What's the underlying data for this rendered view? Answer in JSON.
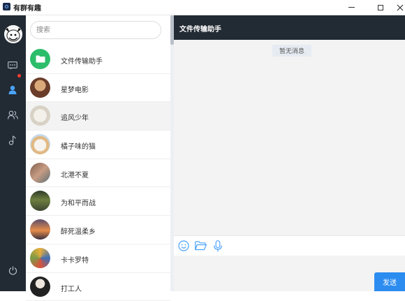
{
  "app": {
    "title": "有群有趣"
  },
  "window": {
    "min_icon": "minimize-icon",
    "max_icon": "maximize-icon",
    "close_icon": "close-icon"
  },
  "rail": {
    "items": [
      {
        "icon": "chat-icon",
        "has_badge": true
      },
      {
        "icon": "contact-icon",
        "active": true
      },
      {
        "icon": "group-icon"
      },
      {
        "icon": "music-note-icon"
      },
      {
        "icon": "power-icon"
      }
    ],
    "accent": "#4aa3ff",
    "badge_color": "#ff3b30"
  },
  "search": {
    "placeholder": "搜索"
  },
  "contacts": [
    {
      "name": "文件传输助手"
    },
    {
      "name": "星梦电影"
    },
    {
      "name": "追风少年",
      "active": true
    },
    {
      "name": "橘子味的猫"
    },
    {
      "name": "北港不夏"
    },
    {
      "name": "为和平而战"
    },
    {
      "name": "醉死温柔乡"
    },
    {
      "name": "卡卡罗特"
    },
    {
      "name": "打工人"
    }
  ],
  "chat": {
    "title": "文件传输助手",
    "empty_text": "暂无消息",
    "tools": [
      "smile-icon",
      "folder-icon",
      "microphone-icon"
    ],
    "send_label": "发送",
    "send_color": "#2d8cf0"
  }
}
